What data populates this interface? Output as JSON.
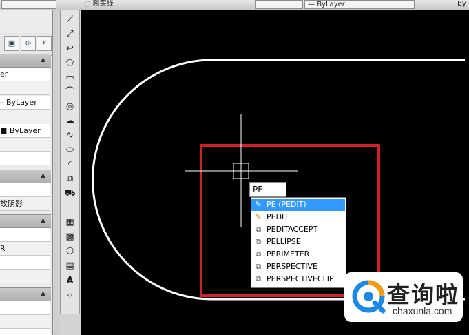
{
  "topbar": {
    "layer_combo": "粗实线",
    "bylayer_combo": "ByLayer",
    "right_fragment": "By"
  },
  "properties_panel": {
    "rows": [
      "er",
      "",
      "– ByLayer",
      "",
      "■ ByLayer",
      "",
      "",
      "",
      "故阴影",
      "",
      "R",
      "",
      "",
      "",
      "",
      "",
      ""
    ]
  },
  "draw_toolbar": {
    "tools": [
      "line-icon",
      "xline-icon",
      "polyline-icon",
      "polygon-icon",
      "rectangle-icon",
      "arc-icon",
      "circle-icon",
      "revcloud-icon",
      "spline-icon",
      "ellipse-icon",
      "ellipse-arc-icon",
      "insert-block-icon",
      "make-block-icon",
      "point-icon",
      "hatch-icon",
      "gradient-icon",
      "region-icon",
      "table-icon",
      "mtext-icon",
      "add-selected-icon"
    ]
  },
  "command": {
    "input_text": "PE",
    "suggestions": [
      {
        "label": "PE (PEDIT)",
        "icon": "pencil-icon",
        "selected": true
      },
      {
        "label": "PEDIT",
        "icon": "pencil-icon",
        "selected": false
      },
      {
        "label": "PEDITACCEPT",
        "icon": "command-icon",
        "selected": false
      },
      {
        "label": "PELLIPSE",
        "icon": "command-icon",
        "selected": false
      },
      {
        "label": "PERIMETER",
        "icon": "command-icon",
        "selected": false
      },
      {
        "label": "PERSPECTIVE",
        "icon": "command-icon",
        "selected": false
      },
      {
        "label": "PERSPECTIVECLIP",
        "icon": "command-icon",
        "selected": false
      }
    ]
  },
  "watermark": {
    "cn": "查询啦",
    "en": "chaxunla.com"
  },
  "colors": {
    "canvas_bg": "#000000",
    "geometry": "#ffffff",
    "highlight_box": "#d0202a",
    "selection": "#3399ff",
    "watermark_blue": "#1e88e5",
    "watermark_orange": "#f39c12"
  }
}
